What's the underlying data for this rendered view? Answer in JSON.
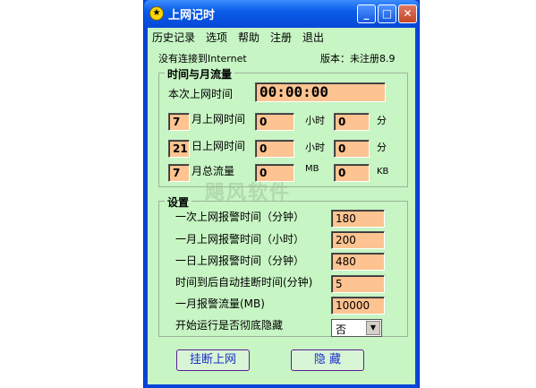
{
  "window": {
    "title": "上网记时"
  },
  "menu": [
    "历史记录",
    "选项",
    "帮助",
    "注册",
    "退出"
  ],
  "status": "没有连接到Internet",
  "version": "版本：未注册8.9",
  "time_group": {
    "title": "时间与月流量",
    "session_label": "本次上网时间",
    "session_value": "00:00:00",
    "month_time": {
      "num": "7",
      "label": "月上网时间",
      "hours": "0",
      "hours_unit": "小时",
      "minutes": "0",
      "minutes_unit": "分"
    },
    "day_time": {
      "num": "21",
      "label": "日上网时间",
      "hours": "0",
      "hours_unit": "小时",
      "minutes": "0",
      "minutes_unit": "分"
    },
    "month_traffic": {
      "num": "7",
      "label": "月总流量",
      "mb": "0",
      "mb_unit": "MB",
      "kb": "0",
      "kb_unit": "KB"
    }
  },
  "settings": {
    "title": "设置",
    "rows": [
      {
        "label": "一次上网报警时间（分钟）",
        "value": "180"
      },
      {
        "label": "一月上网报警时间（小时）",
        "value": "200"
      },
      {
        "label": "一日上网报警时间（分钟）",
        "value": "480"
      },
      {
        "label": "时间到后自动挂断时间(分钟)",
        "value": "5"
      },
      {
        "label": "一月报警流量(MB)",
        "value": "10000"
      }
    ],
    "hide_label": "开始运行是否彻底隐藏",
    "hide_value": "否"
  },
  "buttons": {
    "hangup": "挂断上网",
    "hide": "隐 藏"
  },
  "watermark": "飓风软件"
}
